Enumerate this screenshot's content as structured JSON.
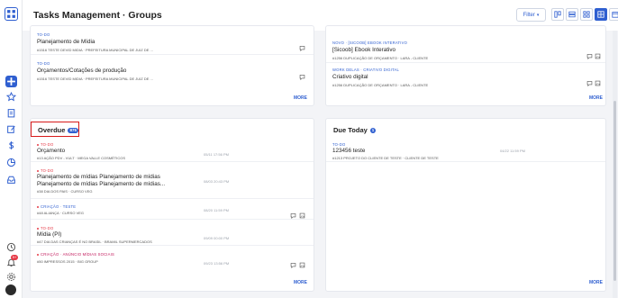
{
  "header": {
    "title": "Tasks Management · Groups",
    "filter_label": "Filter"
  },
  "rail": {
    "icons": [
      "app-logo-icon",
      "add-icon",
      "star-icon",
      "tasks-icon",
      "edit-icon",
      "dollar-icon",
      "chart-icon",
      "inbox-icon",
      "clock-icon",
      "bell-icon",
      "settings-icon",
      "avatar"
    ],
    "notification_count": "9+"
  },
  "panels": {
    "top_left": {
      "more": "MORE",
      "tasks": [
        {
          "tag": "TO-DO",
          "name": "Planejamento de Mídia",
          "sub": "#1516 TESTE DEVID MIDIA  ·  PREFEITURA MUNICIPAL DE JUIZ DE ..."
        },
        {
          "tag": "TO-DO",
          "name": "Orçamentos/Cotações de produção",
          "sub": "#1516 TESTE DEVID MIDIA  ·  PREFEITURA MUNICIPAL DE JUIZ DE ..."
        }
      ]
    },
    "top_right": {
      "more": "MORE",
      "tasks": [
        {
          "tag": "NOVO  ·  [SICOOB] EBOOK INTERATIVO",
          "name": "[Sicoob] Ebook Interativo",
          "sub": "#1256 DUPLICAÇÃO DE ORÇAMENTO  ·  LARA - CLIENTE"
        },
        {
          "tag": "WORK DELAS  ·  CRIATIVO DIGITAL",
          "name": "Criativo digital",
          "sub": "#1256 DUPLICAÇÃO DE ORÇAMENTO  ·  LARA - CLIENTE"
        }
      ]
    },
    "overdue": {
      "title": "Overdue",
      "badge": "875",
      "more": "MORE",
      "tasks": [
        {
          "tag": "TO-DO",
          "name": "Orçamento",
          "sub": "#13 AÇÃO PDV - VULT  ·  MEGA VALLE COSMÉTICOS",
          "date": "05/11 17:56 PM"
        },
        {
          "tag": "TO-DO",
          "name": "Planejamento de mídias Planejamento de mídias",
          "name2": "Planejamento de mídias Planejamento de mídias...",
          "sub": "#38 DIA DOS PAIS  ·  CURSO VEG",
          "date": "08/03 20:43 PM"
        },
        {
          "tag": "CRIAÇÃO  ·  TESTE",
          "name": "",
          "sub": "#48 ALIANÇA  ·  CURSO VEG",
          "date": "08/20 11:59 PM"
        },
        {
          "tag": "TO-DO",
          "name": "Mídia (PI)",
          "sub": "#47 DIA DAS CRIANÇAS É NO BRASIL  ·  BRAMIL SUPERMERCADOS",
          "date": "09/09 00:00 PM"
        },
        {
          "tag": "CRIAÇÃO  ·  ANÚNCIO MÍDIAS SOCIAIS",
          "name": "",
          "sub": "#50 IMPRESSOS 2015  ·  BIG GROUP",
          "date": "09/23 13:56 PM"
        }
      ]
    },
    "due_today": {
      "title": "Due Today",
      "badge": "1",
      "more": "MORE",
      "tasks": [
        {
          "tag": "TO-DO",
          "name": "123456 teste",
          "sub": "#1213 PROJETO DO CLIENTE DE TESTE  ·  CLIENTE DE TESTE",
          "date": "04/22 11:59 PM"
        }
      ]
    }
  },
  "colors": {
    "accent": "#2f5fd0",
    "overdue_highlight": "#d71a1a",
    "red_dot": "#e63946"
  }
}
